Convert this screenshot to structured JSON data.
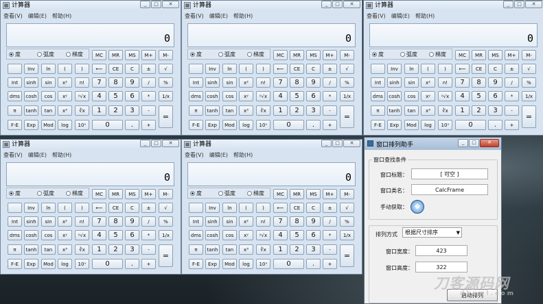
{
  "calculator": {
    "title": "计算器",
    "menu": [
      "查看(V)",
      "编辑(E)",
      "帮助(H)"
    ],
    "display": "0",
    "angle_modes": [
      {
        "label": "度",
        "selected": true
      },
      {
        "label": "弧度",
        "selected": false
      },
      {
        "label": "梯度",
        "selected": false
      }
    ],
    "window_buttons": [
      "_",
      "□",
      "✕"
    ],
    "keys": [
      [
        "MC",
        "MR",
        "MS",
        "M+",
        "M-"
      ],
      [
        "",
        "Inv",
        "ln",
        "(",
        ")",
        "⟵",
        "CE",
        "C",
        "±",
        "√"
      ],
      [
        "Int",
        "sinh",
        "sin",
        "x²",
        "n!",
        "7",
        "8",
        "9",
        "/",
        "%"
      ],
      [
        "dms",
        "cosh",
        "cos",
        "xʸ",
        "ʸ√x",
        "4",
        "5",
        "6",
        "*",
        "1/x"
      ],
      [
        "π",
        "tanh",
        "tan",
        "x³",
        "∛x",
        "1",
        "2",
        "3",
        "-",
        "="
      ],
      [
        "F-E",
        "Exp",
        "Mod",
        "log",
        "10ˣ",
        "0",
        ".",
        "+"
      ]
    ]
  },
  "helper": {
    "title": "窗口排列助手",
    "search_group_title": "窗口查找条件",
    "window_title_label": "窗口标题：",
    "window_title_value": "[ 可空 ]",
    "class_label": "窗口类名：",
    "class_value": "CalcFrame",
    "manual_label": "手动获取：",
    "arrange_label": "排列方式",
    "arrange_value": "根据尺寸排序",
    "width_label": "窗口宽度：",
    "width_value": "423",
    "height_label": "窗口高度：",
    "height_value": "322",
    "start_button": "启动排列"
  },
  "watermark": {
    "text": "刀客源码网",
    "sub": "dkewl.com"
  }
}
